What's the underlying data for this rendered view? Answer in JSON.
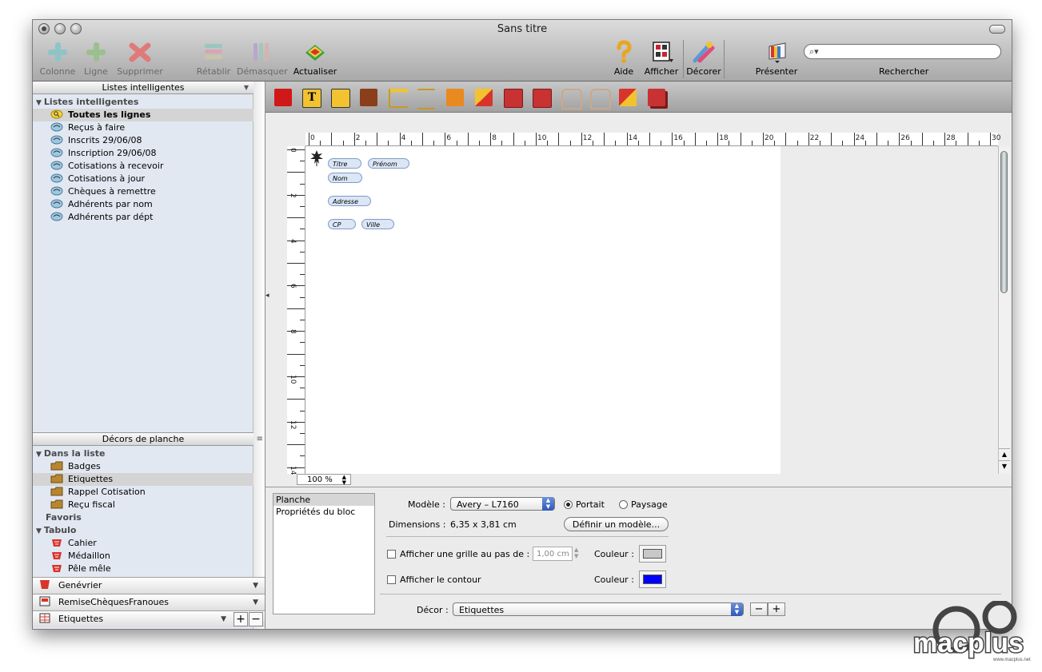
{
  "window": {
    "title": "Sans titre"
  },
  "toolbar": {
    "buttons": [
      {
        "label": "Colonne",
        "icon": "column-icon",
        "enabled": false
      },
      {
        "label": "Ligne",
        "icon": "row-icon",
        "enabled": false
      },
      {
        "label": "Supprimer",
        "icon": "delete-icon",
        "enabled": false
      },
      {
        "label": "Rétablir",
        "icon": "restore-icon",
        "enabled": false
      },
      {
        "label": "Démasquer",
        "icon": "unmask-icon",
        "enabled": false
      },
      {
        "label": "Actualiser",
        "icon": "refresh-icon",
        "enabled": true
      },
      {
        "label": "Aide",
        "icon": "help-icon",
        "enabled": true
      },
      {
        "label": "Afficher",
        "icon": "display-icon",
        "enabled": true
      },
      {
        "label": "Décorer",
        "icon": "decorate-icon",
        "enabled": true
      },
      {
        "label": "Présenter",
        "icon": "present-icon",
        "enabled": true
      }
    ],
    "search": {
      "label": "Rechercher",
      "value": ""
    }
  },
  "sidebar": {
    "smart_lists": {
      "header": "Listes intelligentes",
      "group": "Listes intelligentes",
      "items": [
        "Toutes les lignes",
        "Reçus à faire",
        "Inscrits 29/06/08",
        "Inscription 29/06/08",
        "Cotisations à recevoir",
        "Cotisations à jour",
        "Chèques à remettre",
        "Adhérents par nom",
        "Adhérents par dépt"
      ],
      "selected": 0
    },
    "decors": {
      "header": "Décors de planche",
      "group1": "Dans la liste",
      "group1_items": [
        "Badges",
        "Etiquettes",
        "Rappel Cotisation",
        "Reçu fiscal"
      ],
      "selected": 1,
      "favoris": "Favoris",
      "group2": "Tabulo",
      "group2_items": [
        "Cahier",
        "Médaillon",
        "Pêle mêle"
      ]
    },
    "bottom_rows": [
      "Genévrier",
      "RemiseChèquesFranoues",
      "Etiquettes"
    ]
  },
  "editor": {
    "ruler_h": [
      "0",
      "2",
      "4",
      "6",
      "8",
      "10",
      "12",
      "14",
      "16",
      "18",
      "20",
      "22",
      "24",
      "26",
      "28",
      "30"
    ],
    "ruler_v": [
      "0",
      "2",
      "4",
      "6",
      "8",
      "10",
      "12",
      "14"
    ],
    "fields": [
      "Titre",
      "Prénom",
      "Nom",
      "Adresse",
      "CP",
      "Ville"
    ],
    "zoom": "100 %"
  },
  "panel": {
    "tabs": [
      "Planche",
      "Propriétés du bloc"
    ],
    "modele_label": "Modèle :",
    "modele_value": "Avery – L7160",
    "orientation": [
      "Portait",
      "Paysage"
    ],
    "orientation_selected": 0,
    "dimensions_label": "Dimensions :",
    "dimensions_value": "6,35 x 3,81 cm",
    "define_button": "Définir un modèle...",
    "grid_label": "Afficher une grille au pas de :",
    "grid_value": "1,00 cm",
    "couleur_label": "Couleur :",
    "grid_color": "#c8c8c8",
    "contour_label": "Afficher le contour",
    "contour_color": "#0000ff",
    "decor_label": "Décor :",
    "decor_value": "Etiquettes"
  },
  "brand": {
    "logo_text": "macplus",
    "logo_sub": "www.macplus.net"
  }
}
